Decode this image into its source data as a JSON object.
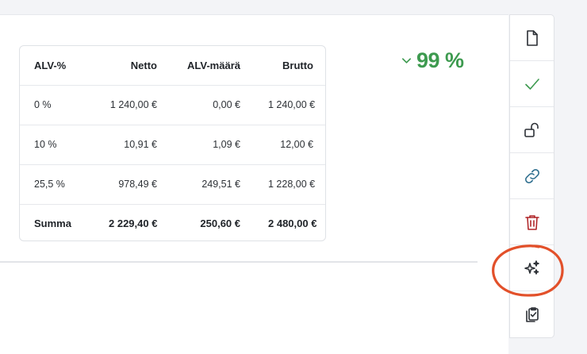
{
  "vat_table": {
    "headers": [
      "ALV-%",
      "Netto",
      "ALV-määrä",
      "Brutto"
    ],
    "rows": [
      [
        "0 %",
        "1 240,00 €",
        "0,00 €",
        "1 240,00 €"
      ],
      [
        "10 %",
        "10,91 €",
        "1,09 €",
        "12,00 €"
      ],
      [
        "25,5 %",
        "978,49 €",
        "249,51 €",
        "1 228,00 €"
      ]
    ],
    "total": [
      "Summa",
      "2 229,40 €",
      "250,60 €",
      "2 480,00 €"
    ]
  },
  "confidence": {
    "value": "99 %",
    "color": "#3d9a4f"
  },
  "toolbar": {
    "tools": [
      {
        "icon": "document-icon",
        "color": "#2b2f35"
      },
      {
        "icon": "check-icon",
        "color": "#3d9a4f"
      },
      {
        "icon": "unlock-icon",
        "color": "#2b2f35"
      },
      {
        "icon": "link-icon",
        "color": "#2f6f8f"
      },
      {
        "icon": "trash-icon",
        "color": "#b0272a"
      },
      {
        "icon": "sparkles-icon",
        "color": "#2b2f35"
      },
      {
        "icon": "clipboard-check-icon",
        "color": "#2b2f35"
      }
    ]
  },
  "annotation": {
    "color": "#e2502a"
  }
}
